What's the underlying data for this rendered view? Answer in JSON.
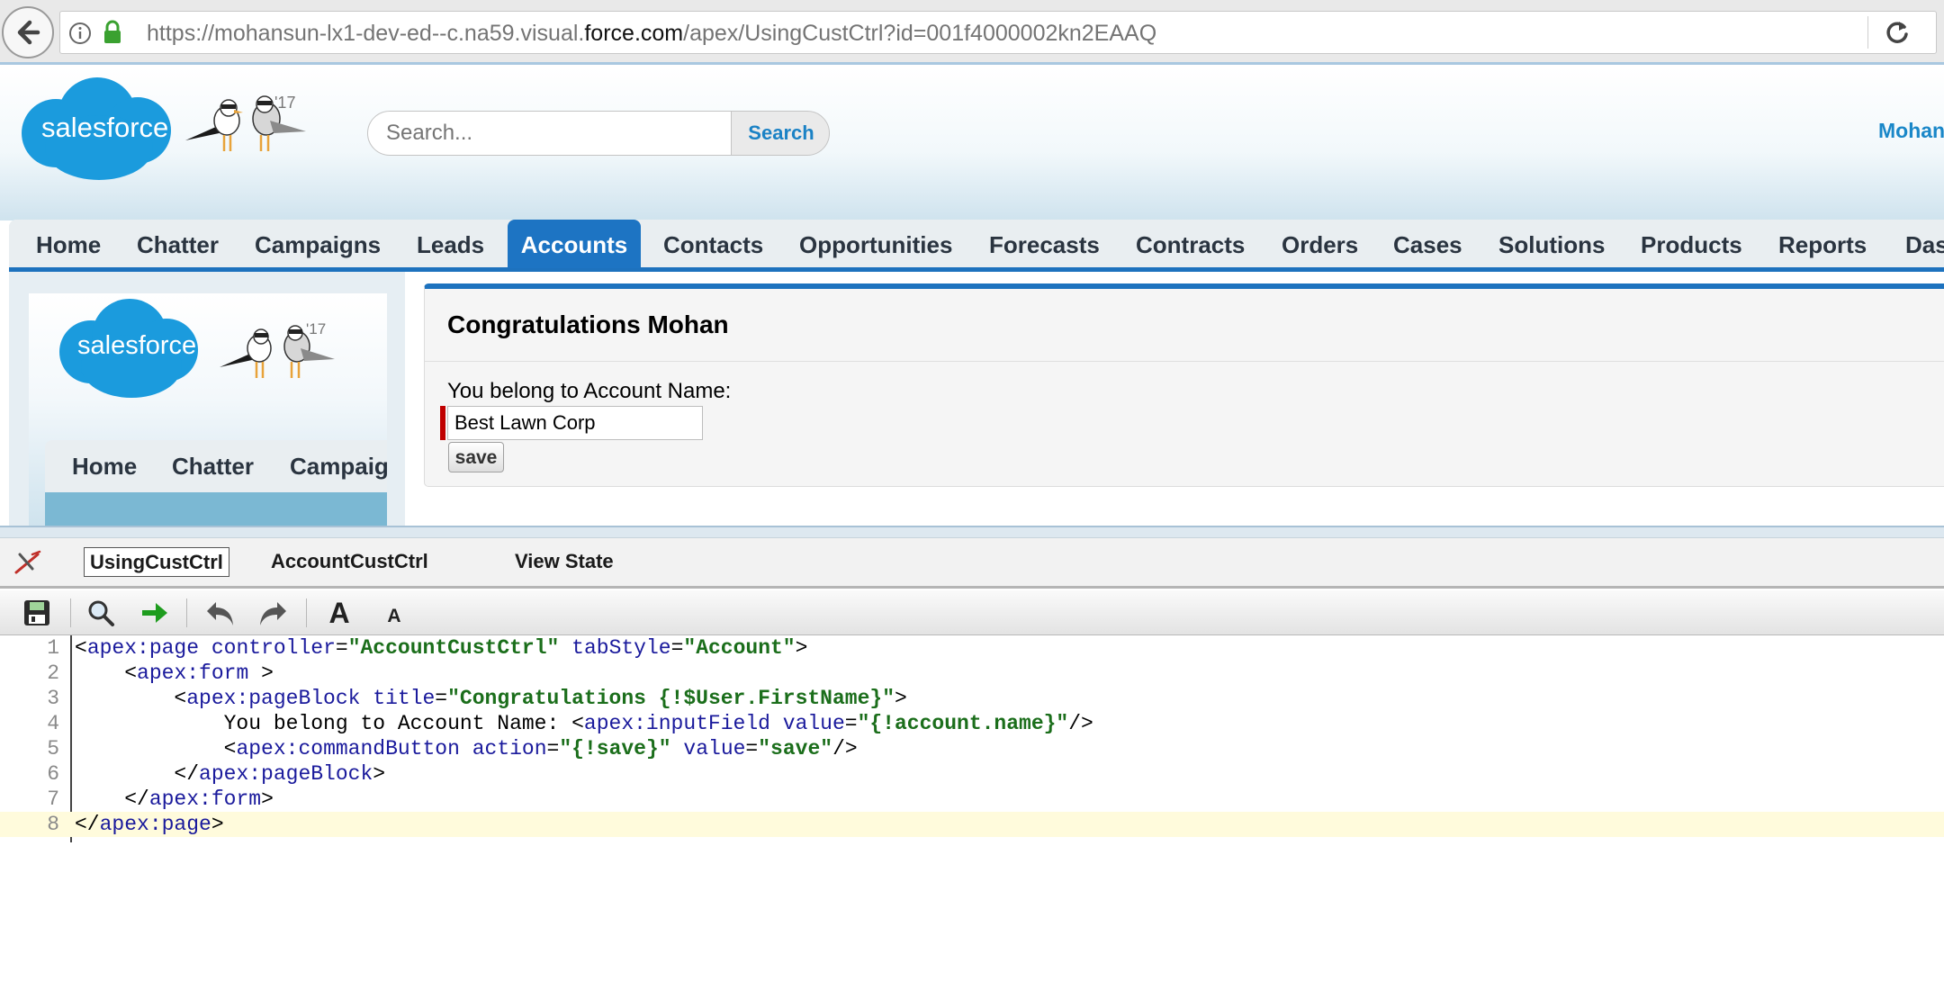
{
  "browser": {
    "url_prefix": "https://mohansun-lx1-dev-ed--c.na59.visual.",
    "url_host": "force.com",
    "url_path": "/apex/UsingCustCtrl?id=001f4000002kn2EAAQ"
  },
  "header": {
    "logo_text": "salesforce",
    "release_badge": "'17",
    "search_placeholder": "Search...",
    "search_button": "Search",
    "user_name": "Mohan"
  },
  "nav_tabs": [
    "Home",
    "Chatter",
    "Campaigns",
    "Leads",
    "Accounts",
    "Contacts",
    "Opportunities",
    "Forecasts",
    "Contracts",
    "Orders",
    "Cases",
    "Solutions",
    "Products",
    "Reports",
    "Das"
  ],
  "active_tab": "Accounts",
  "left_frame": {
    "logo_text": "salesforce",
    "release_badge": "'17",
    "tabs": [
      "Home",
      "Chatter",
      "Campaig"
    ]
  },
  "page_block": {
    "title": "Congratulations Mohan",
    "field_label": "You belong to Account Name:",
    "field_value": "Best Lawn Corp",
    "save_button": "save"
  },
  "dev_mode": {
    "tabs": [
      "UsingCustCtrl",
      "AccountCustCtrl",
      "View State"
    ],
    "active_tab": "UsingCustCtrl",
    "toolbar_icons": [
      "save-icon",
      "search-icon",
      "go-to-line-icon",
      "undo-icon",
      "redo-icon",
      "increase-font-icon",
      "decrease-font-icon"
    ],
    "font_large_label": "A",
    "font_small_label": "A",
    "code_lines": [
      "<apex:page controller=\"AccountCustCtrl\" tabStyle=\"Account\">",
      "    <apex:form >",
      "        <apex:pageBlock title=\"Congratulations {!$User.FirstName}\">",
      "            You belong to Account Name: <apex:inputField value=\"{!account.name}\"/>",
      "            <apex:commandButton action=\"{!save}\" value=\"save\"/>",
      "        </apex:pageBlock>",
      "    </apex:form>",
      "</apex:page>"
    ],
    "current_line": 8
  },
  "colors": {
    "brand_blue": "#1b9bdd",
    "tab_active": "#1d74c3",
    "required_red": "#c00000",
    "code_tag": "#1a1a9c",
    "code_value": "#1b6e1b"
  }
}
